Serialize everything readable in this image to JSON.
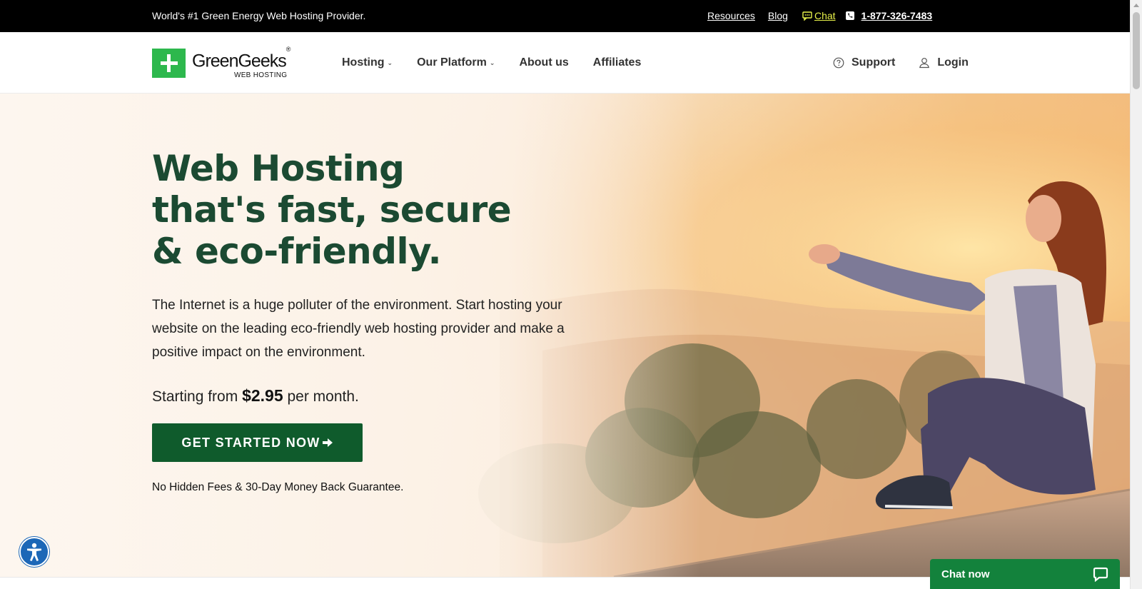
{
  "topbar": {
    "tagline": "World's #1 Green Energy Web Hosting Provider.",
    "resources": "Resources",
    "blog": "Blog",
    "chat": "Chat",
    "phone": "1-877-326-7483"
  },
  "logo": {
    "name": "GreenGeeks",
    "trademark": "®",
    "subtitle": "WEB HOSTING"
  },
  "nav": {
    "items": [
      {
        "label": "Hosting",
        "has_dropdown": true
      },
      {
        "label": "Our Platform",
        "has_dropdown": true
      },
      {
        "label": "About us",
        "has_dropdown": false
      },
      {
        "label": "Affiliates",
        "has_dropdown": false
      }
    ],
    "support": "Support",
    "login": "Login"
  },
  "hero": {
    "headline": "Web Hosting that's fast, secure & eco-friendly.",
    "description": "The Internet is a huge polluter of the environment. Start hosting your website on the leading eco-friendly web hosting provider and make a positive impact on the environment.",
    "price_prefix": "Starting from",
    "price": "$2.95",
    "price_suffix": "per month.",
    "cta": "GET STARTED NOW",
    "guarantee": "No Hidden Fees & 30-Day Money Back Guarantee."
  },
  "chat_widget": {
    "label": "Chat now"
  },
  "colors": {
    "brand_green": "#2db84d",
    "headline_green": "#1b4a32",
    "cta_green": "#0f5b2c",
    "chat_green": "#13823c",
    "chat_link_yellow": "#e8f24a",
    "a11y_blue": "#1c67b7"
  },
  "icons": {
    "chat": "chat-bubble-icon",
    "phone": "phone-icon",
    "support": "question-circle-icon",
    "login": "user-icon",
    "cta": "arrow-right-icon",
    "accessibility": "accessibility-person-icon",
    "chat_widget": "speech-bubble-icon"
  }
}
